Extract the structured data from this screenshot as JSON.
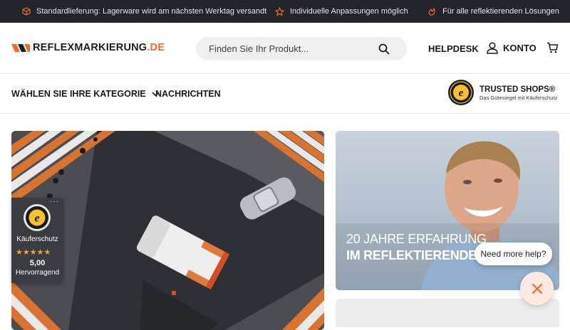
{
  "topbar": {
    "usps": [
      {
        "icon": "box-icon",
        "text": "Standardlieferung: Lagerware wird am nächsten Werktag versandt"
      },
      {
        "icon": "star-icon",
        "text": "Individuelle Anpassungen möglich"
      },
      {
        "icon": "flame-icon",
        "text": "Für alle reflektierenden Lösungen"
      }
    ]
  },
  "header": {
    "logo_text": "REFLEXMARKIERUNG",
    "logo_tld": ".DE",
    "search_placeholder": "Finden Sie Ihr Produkt...",
    "helpdesk": "HELPDESK",
    "account": "KONTO"
  },
  "nav": {
    "category": "WÄHLEN SIE IHRE KATEGORIE",
    "news": "NACHRICHTEN",
    "trusted_title": "TRUSTED SHOPS®",
    "trusted_sub": "Das Gütesiegel mit Käuferschutz"
  },
  "hero": {
    "right_line1": "20 JAHRE ERFAHRUNG",
    "right_line2": "IM REFLEKTIERENDEN M"
  },
  "trust_widget": {
    "label": "Käuferschutz",
    "stars": "★★★★★",
    "score": "5,00",
    "rating_text": "Hervorragend",
    "more": "···"
  },
  "chat": {
    "prompt": "Need more help?"
  },
  "colors": {
    "accent": "#ef6a2b",
    "topbar_bg": "#24252a"
  }
}
